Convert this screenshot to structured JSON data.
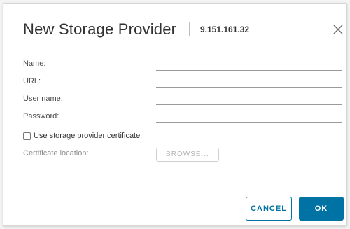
{
  "dialog": {
    "title": "New Storage Provider",
    "subtitle": "9.151.161.32",
    "close_icon": "close-icon"
  },
  "form": {
    "name_label": "Name:",
    "name_value": "",
    "url_label": "URL:",
    "url_value": "",
    "username_label": "User name:",
    "username_value": "",
    "password_label": "Password:",
    "password_value": "",
    "certificate_checkbox_label": "Use storage provider certificate",
    "certificate_checked": false,
    "certificate_location_label": "Certificate location:",
    "browse_label": "BROWSE..."
  },
  "footer": {
    "cancel_label": "CANCEL",
    "ok_label": "OK"
  },
  "colors": {
    "accent": "#0072a3"
  }
}
